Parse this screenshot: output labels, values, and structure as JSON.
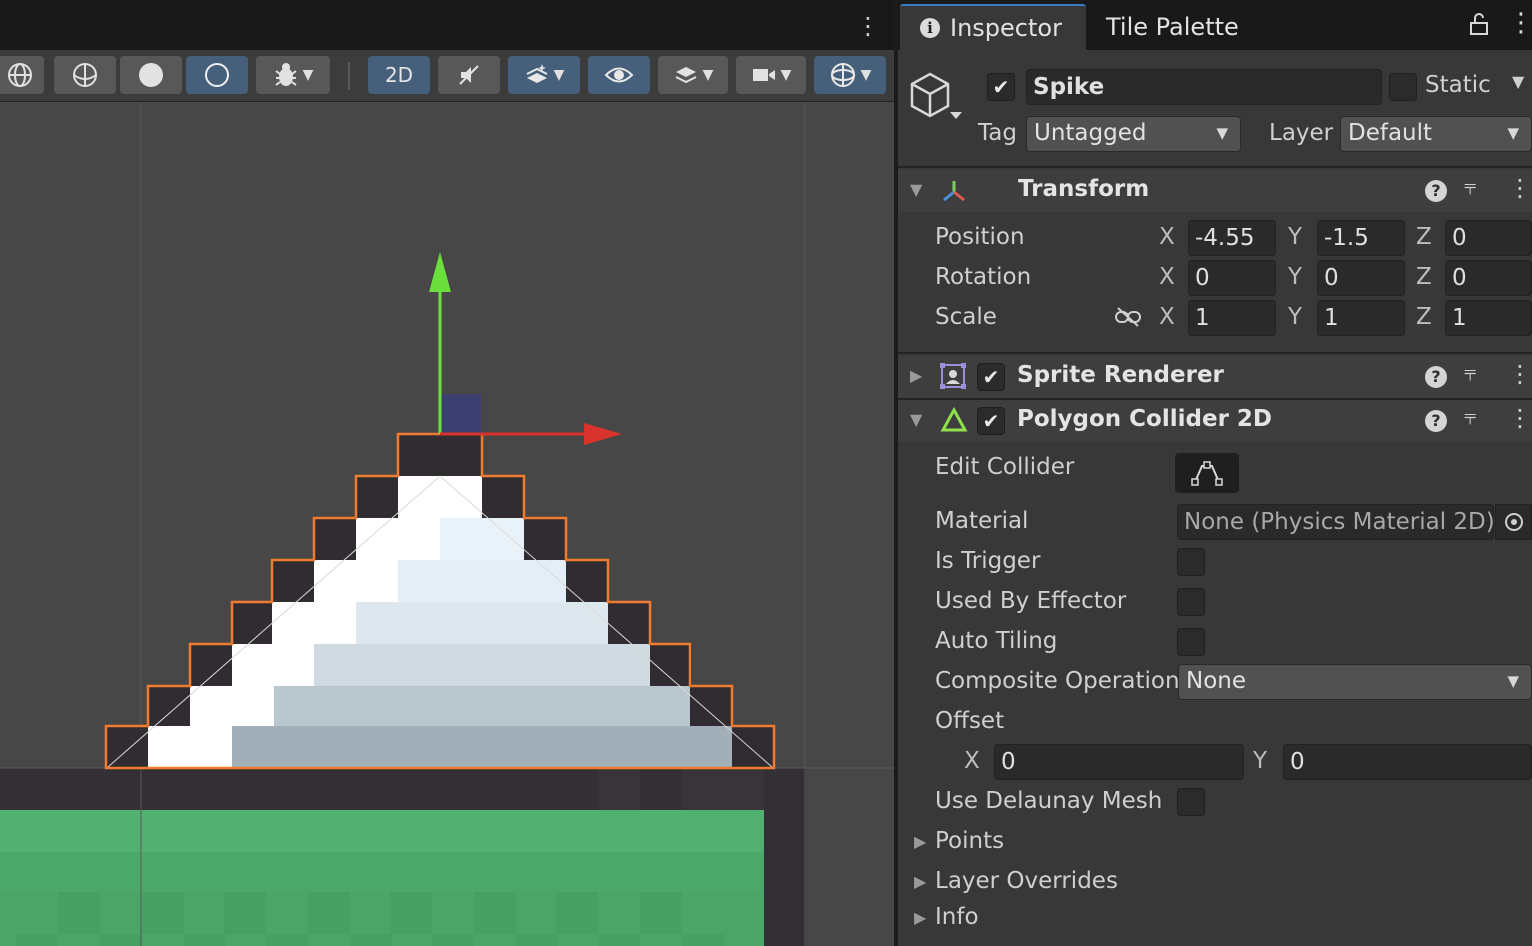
{
  "tabs": {
    "inspector": "Inspector",
    "tile_palette": "Tile Palette"
  },
  "object": {
    "active": true,
    "name": "Spike",
    "static_label": "Static",
    "static": false,
    "tag_label": "Tag",
    "tag": "Untagged",
    "layer_label": "Layer",
    "layer": "Default"
  },
  "transform": {
    "title": "Transform",
    "position": {
      "label": "Position",
      "x": "-4.55",
      "y": "-1.5",
      "z": "0"
    },
    "rotation": {
      "label": "Rotation",
      "x": "0",
      "y": "0",
      "z": "0"
    },
    "scale": {
      "label": "Scale",
      "x": "1",
      "y": "1",
      "z": "1"
    },
    "axis_x": "X",
    "axis_y": "Y",
    "axis_z": "Z"
  },
  "sprite_renderer": {
    "title": "Sprite Renderer",
    "enabled": true
  },
  "polygon_collider": {
    "title": "Polygon Collider 2D",
    "enabled": true,
    "edit_collider_label": "Edit Collider",
    "material_label": "Material",
    "material": "None (Physics Material 2D)",
    "is_trigger_label": "Is Trigger",
    "is_trigger": false,
    "used_by_effector_label": "Used By Effector",
    "used_by_effector": false,
    "auto_tiling_label": "Auto Tiling",
    "auto_tiling": false,
    "composite_operation_label": "Composite Operation",
    "composite_operation": "None",
    "offset_label": "Offset",
    "offset_x_label": "X",
    "offset_x": "0",
    "offset_y_label": "Y",
    "offset_y": "0",
    "use_delaunay_label": "Use Delaunay Mesh",
    "use_delaunay": false,
    "points_label": "Points",
    "layer_overrides_label": "Layer Overrides",
    "info_label": "Info"
  },
  "scene_toolbar": {
    "mode_2d": "2D"
  },
  "colors": {
    "accent": "#46607c",
    "collider_outline": "#f07a2f",
    "grass": "#4ca86a",
    "axis_y": "#6be03c",
    "axis_x": "#d9342b"
  },
  "icons": [
    "globe-icon",
    "lit-sphere-icon",
    "solid-circle-icon",
    "shaded-moon-icon",
    "bug-icon",
    "audio-mute-icon",
    "layers-icon",
    "visibility-icon",
    "stack-icon",
    "camera-icon",
    "gizmo-icon",
    "lock-icon",
    "more-icon",
    "help-icon",
    "settings-icon",
    "cube-icon",
    "link-icon",
    "edit-collider-icon",
    "target-icon"
  ]
}
